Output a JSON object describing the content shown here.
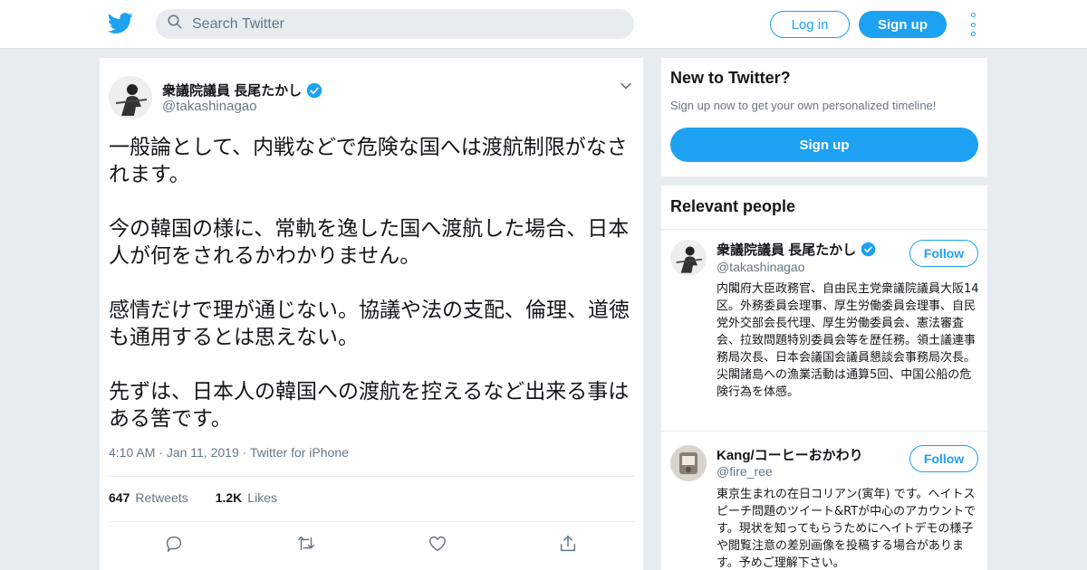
{
  "colors": {
    "accent": "#1da1f2",
    "background": "#e6ecf0",
    "muted": "#657786",
    "text": "#14171a"
  },
  "topbar": {
    "logo_icon": "twitter-bird-icon",
    "search_placeholder": "Search Twitter",
    "login_label": "Log in",
    "signup_label": "Sign up",
    "more_icon": "vertical-dots-icon"
  },
  "tweet": {
    "author_name": "衆議院議員 長尾たかし",
    "author_handle": "@takashinagao",
    "verified": true,
    "paragraphs": [
      "一般論として、内戦などで危険な国へは渡航制限がなされます。",
      "今の韓国の様に、常軌を逸した国へ渡航した場合、日本人が何をされるかわかりません。",
      "感情だけで理が通じない。協議や法の支配、倫理、道徳も通用するとは思えない。",
      "先ずは、日本人の韓国への渡航を控えるなど出来る事はある筈です。"
    ],
    "time": "4:10 AM",
    "date": "Jan 11, 2019",
    "source": "Twitter for iPhone",
    "retweets_count": "647",
    "retweets_label": "Retweets",
    "likes_count": "1.2K",
    "likes_label": "Likes"
  },
  "sidebar": {
    "new_to": {
      "title": "New to Twitter?",
      "subtitle": "Sign up now to get your own personalized timeline!",
      "button": "Sign up"
    },
    "relevant": {
      "title": "Relevant people",
      "people": [
        {
          "name": "衆議院議員 長尾たかし",
          "handle": "@takashinagao",
          "verified": true,
          "follow_label": "Follow",
          "bio": "内閣府大臣政務官、自由民主党衆議院議員大阪14区。外務委員会理事、厚生労働委員会理事、自民党外交部会長代理、厚生労働委員会、憲法審査会、拉致問題特別委員会等を歴任務。領土議連事務局次長、日本会議国会議員懇談会事務局次長。尖閣諸島への漁業活動は通算5回、中国公船の危険行為を体感。"
        },
        {
          "name": "Kang/コーヒーおかわり",
          "handle": "@fire_ree",
          "verified": false,
          "follow_label": "Follow",
          "bio": "東京生まれの在日コリアン(寅年) です。ヘイトスピーチ問題のツイート&RTが中心のアカウントです。現状を知ってもらうためにヘイトデモの様子や閲覧注意の差別画像を投稿する場合があります。予めご理解下さい。"
        }
      ]
    }
  }
}
